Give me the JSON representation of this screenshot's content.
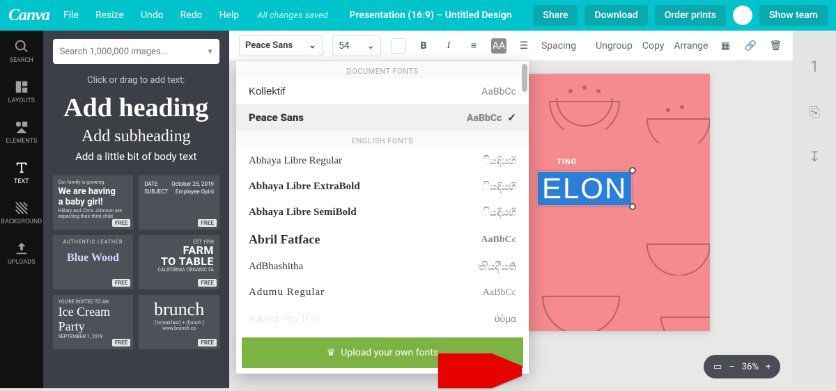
{
  "brand": "Canva",
  "topmenu": {
    "file": "File",
    "resize": "Resize",
    "undo": "Undo",
    "redo": "Redo",
    "help": "Help"
  },
  "saved_status": "All changes saved",
  "doc_title": "Presentation (16:9) – Untitled Design",
  "top_actions": {
    "share": "Share",
    "download": "Download",
    "order": "Order prints",
    "team": "Show team"
  },
  "rail": {
    "search": "SEARCH",
    "layouts": "LAYOUTS",
    "elements": "ELEMENTS",
    "text": "TEXT",
    "background": "BACKGROUND",
    "uploads": "UPLOADS"
  },
  "search_placeholder": "Search 1,000,000 images...",
  "text_hint": "Click or drag to add text:",
  "text_samples": {
    "h1": "Add heading",
    "h2": "Add subheading",
    "body": "Add a little bit of body text"
  },
  "templates": {
    "baby": {
      "top": "Our family is growing.",
      "line1": "We are having",
      "line2": "a baby girl!",
      "sub": "Hillary and Chris Johnson are expecting their third child"
    },
    "date_card": {
      "date_label": "DATE",
      "date_val": "October 25, 2019",
      "subj_label": "SUBJECT",
      "subj_val": "Employee Opini"
    },
    "farm": {
      "est": "EST 1998",
      "line1": "FARM",
      "line2": "TO TABLE",
      "sub": "CALIFORNIA ORGANIC FA"
    },
    "bluew": {
      "top": "AUTHENTIC LEATHER",
      "title": "Blue Wood"
    },
    "brunch": {
      "title": "brunch",
      "sub": "[ br(eakfast) + (l)unch ]",
      "url": "www.brunch.co"
    },
    "ice": {
      "top": "YOU'RE INVITED TO AN",
      "title": "Ice Cream Party",
      "date": "SEPTEMBER 1, 2019"
    },
    "free": "FREE"
  },
  "toolbar": {
    "font": "Peace Sans",
    "size": "54",
    "bold": "B",
    "italic": "I",
    "spacing": "Spacing",
    "ungroup": "Ungroup",
    "copy": "Copy",
    "arrange": "Arrange"
  },
  "font_dropdown": {
    "section1": "DOCUMENT FONTS",
    "section2": "ENGLISH FONTS",
    "fonts": [
      {
        "name": "Kollektif",
        "preview": "AaBbCc",
        "selected": false
      },
      {
        "name": "Peace Sans",
        "preview": "AaBbCc",
        "selected": true
      },
      {
        "name": "Abhaya Libre Regular",
        "preview": "ියඳියහි",
        "selected": false
      },
      {
        "name": "Abhaya Libre ExtraBold",
        "preview": "ියඳියහි",
        "selected": false
      },
      {
        "name": "Abhaya Libre SemiBold",
        "preview": "ියඳියහි",
        "selected": false
      },
      {
        "name": "Abril Fatface",
        "preview": "AaBbCc",
        "selected": false
      },
      {
        "name": "AdBhashitha",
        "preview": "ත'ියද්'ියති",
        "selected": false
      },
      {
        "name": "Adumu Regular",
        "preview": "AaBbCc",
        "selected": false
      },
      {
        "name": "Advent Pro Thin",
        "preview": "ύὐμα",
        "selected": false
      }
    ],
    "upload": "Upload your own fonts"
  },
  "canvas": {
    "sel_text": "ELON",
    "sub_label": "TING"
  },
  "page_num": "1",
  "zoom": {
    "level": "36%"
  }
}
